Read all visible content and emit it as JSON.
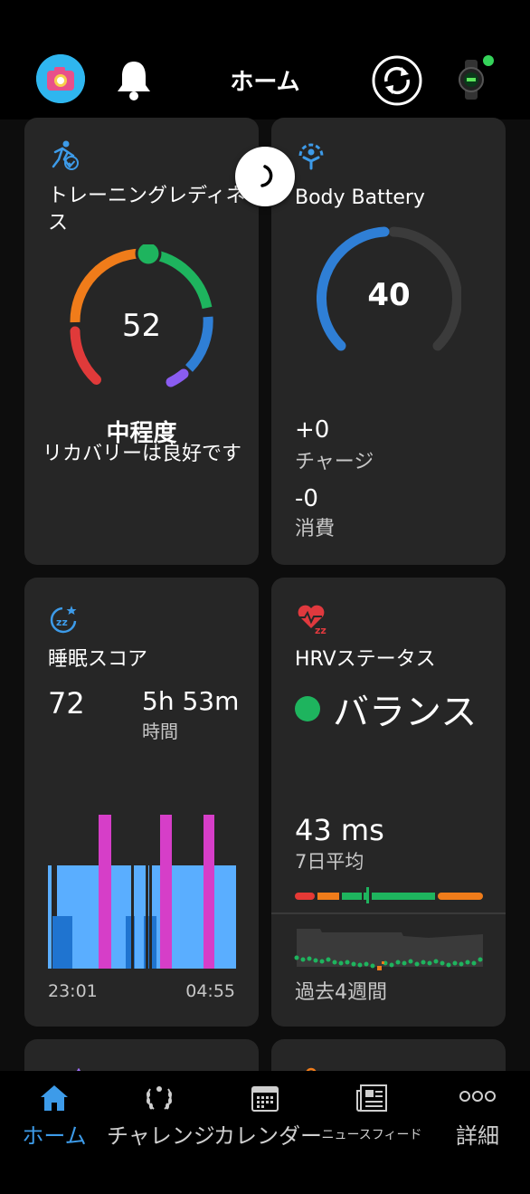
{
  "header": {
    "title": "ホーム"
  },
  "training_readiness": {
    "title": "トレーニングレディネス",
    "score": "52",
    "level": "中程度",
    "description": "リカバリーは良好です"
  },
  "body_battery": {
    "title": "Body Battery",
    "value": "40",
    "charge_value": "+0",
    "charge_label": "チャージ",
    "drain_value": "-0",
    "drain_label": "消費"
  },
  "sleep": {
    "title": "睡眠スコア",
    "score": "72",
    "duration": "5h 53m",
    "duration_label": "時間",
    "start_time": "23:01",
    "end_time": "04:55"
  },
  "hrv": {
    "title": "HRVステータス",
    "status": "バランス",
    "value": "43 ms",
    "value_label": "7日平均",
    "period_label": "過去4週間"
  },
  "nav": {
    "home": "ホーム",
    "challenges": "チャレンジ",
    "calendar": "カレンダー",
    "news_feed": "ニュースフィード",
    "more": "詳細"
  },
  "colors": {
    "accent": "#3d9be9",
    "card": "#262626",
    "sleep_light": "#5aaeff",
    "sleep_deep": "#1f74d0",
    "sleep_awake": "#d63ec8",
    "hrv_green": "#1eb45e",
    "hrv_orange": "#f07c1a",
    "hrv_red": "#e53935"
  }
}
